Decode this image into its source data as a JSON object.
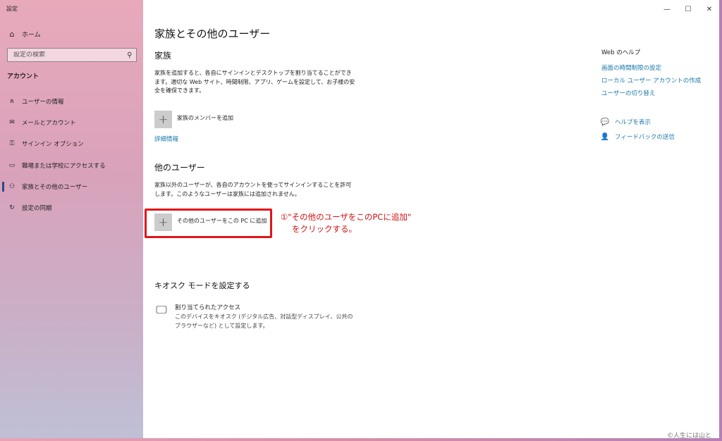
{
  "window": {
    "title": "設定",
    "controls": {
      "minimize": "—",
      "maximize": "☐",
      "close": "✕"
    }
  },
  "sidebar": {
    "home": "ホーム",
    "search_placeholder": "設定の検索",
    "section": "アカウント",
    "items": [
      {
        "label": "ユーザーの情報",
        "icon": "user-card-icon"
      },
      {
        "label": "メールとアカウント",
        "icon": "mail-icon"
      },
      {
        "label": "サインイン オプション",
        "icon": "key-icon"
      },
      {
        "label": "職場または学校にアクセスする",
        "icon": "briefcase-icon"
      },
      {
        "label": "家族とその他のユーザー",
        "icon": "person-icon",
        "active": true
      },
      {
        "label": "設定の同期",
        "icon": "sync-icon"
      }
    ]
  },
  "main": {
    "title": "家族とその他のユーザー",
    "family": {
      "heading": "家族",
      "description": "家族を追加すると、各自にサインインとデスクトップを割り当てることができます。適切な Web サイト、時間制限、アプリ、ゲームを設定して、お子様の安全を確保できます。",
      "add_label": "家族のメンバーを追加",
      "more_info": "詳細情報"
    },
    "other_users": {
      "heading": "他のユーザー",
      "description": "家族以外のユーザーが、各自のアカウントを使ってサインインすることを許可します。このようなユーザーは家族には追加されません。",
      "add_label": "その他のユーザーをこの PC に追加"
    },
    "kiosk": {
      "heading": "キオスク モードを設定する",
      "item_title": "割り当てられたアクセス",
      "item_desc": "このデバイスをキオスク (デジタル広告、対話型ディスプレイ、公共のブラウザーなど) として設定します。"
    },
    "annotation": {
      "line1": "①\"その他のユーザをこのPCに追加\"",
      "line2": "をクリックする。",
      "color": "#d01010"
    }
  },
  "right": {
    "help_title": "Web のヘルプ",
    "links": [
      "画面の時間制限の設定",
      "ローカル ユーザー アカウントの作成",
      "ユーザーの切り替え"
    ],
    "get_help": "ヘルプを表示",
    "feedback": "フィードバックの送信"
  },
  "watermark": "©人生には山と"
}
